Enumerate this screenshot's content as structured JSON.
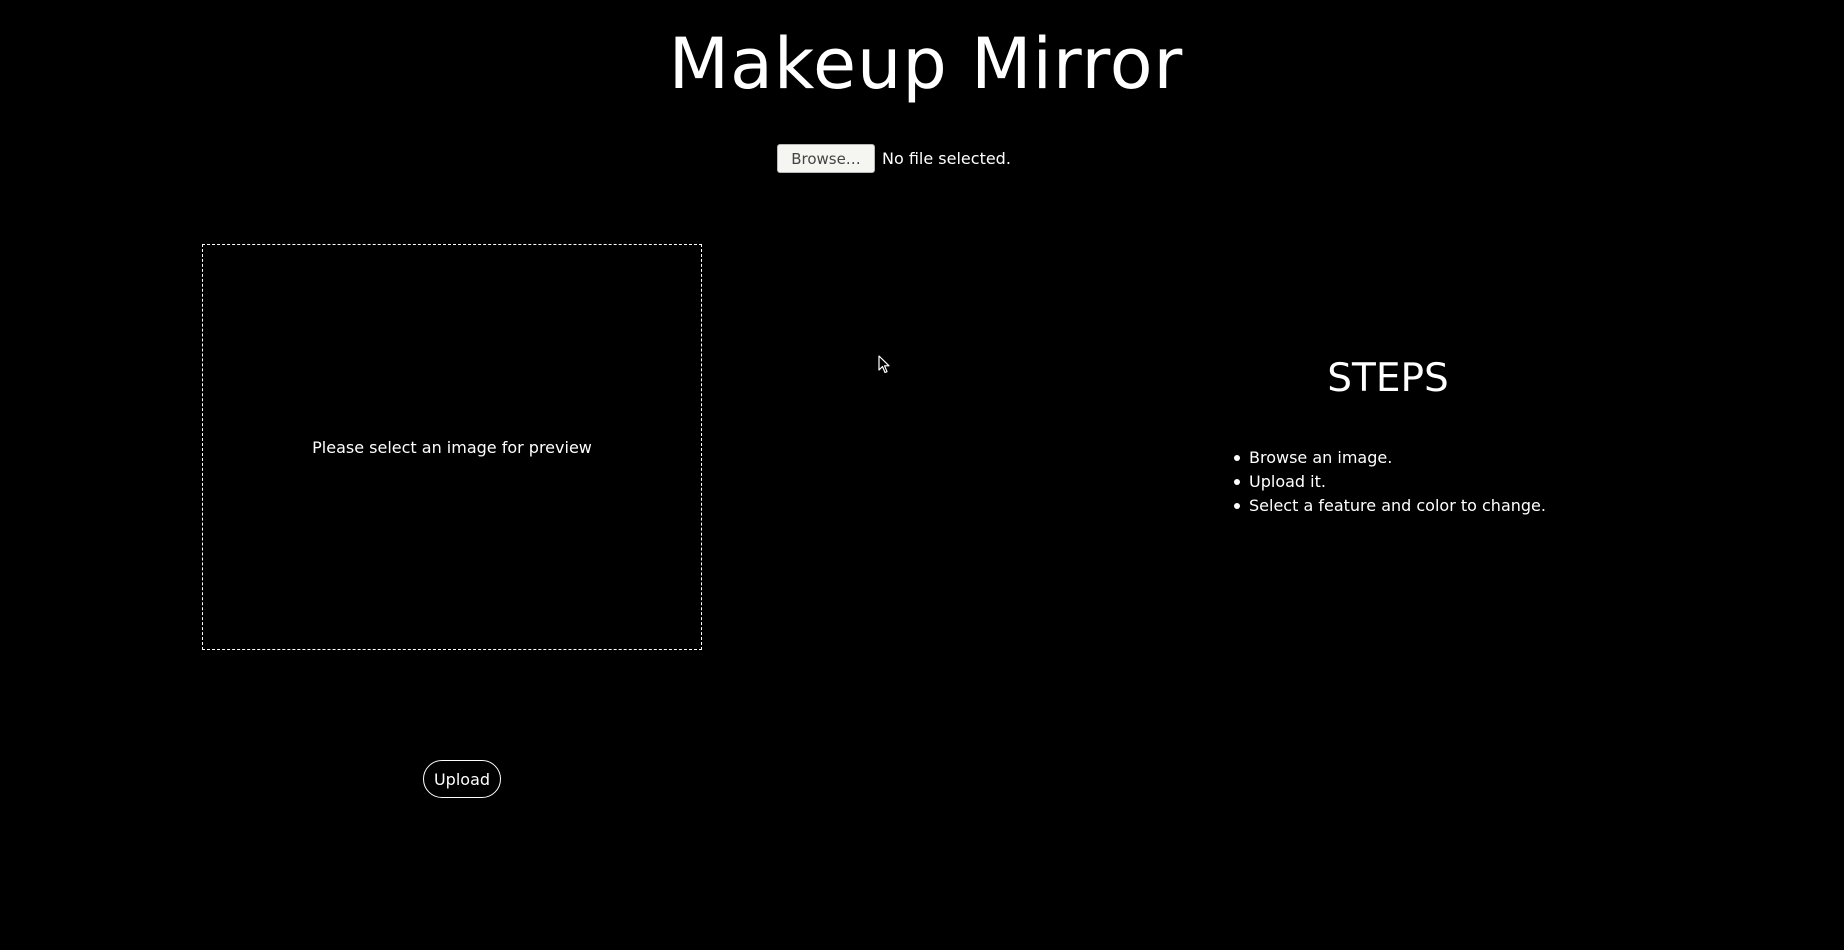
{
  "header": {
    "title": "Makeup Mirror"
  },
  "file_input": {
    "button_label": "Browse…",
    "status_text": "No file selected."
  },
  "preview": {
    "placeholder_text": "Please select an image for preview"
  },
  "upload": {
    "button_label": "Upload"
  },
  "steps": {
    "title": "STEPS",
    "items": [
      "Browse an image.",
      "Upload it.",
      "Select a feature and color to change."
    ]
  },
  "colors": {
    "background": "#000000",
    "text": "#ffffff",
    "browse_button_bg": "#f5f5f1"
  },
  "icons": {
    "cursor": "mouse-pointer-icon"
  }
}
